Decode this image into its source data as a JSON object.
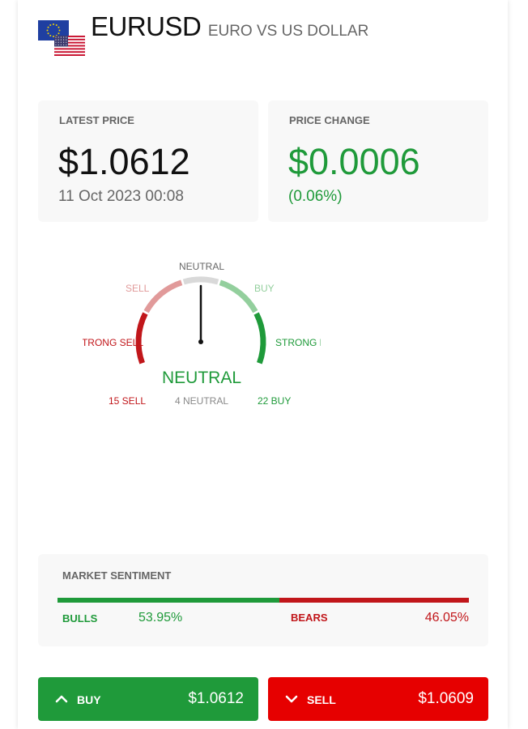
{
  "header": {
    "symbol": "EURUSD",
    "name": "EURO VS US DOLLAR"
  },
  "latest_price": {
    "label": "LATEST PRICE",
    "value": "$1.0612",
    "date": "11 Oct 2023 00:08"
  },
  "price_change": {
    "label": "PRICE CHANGE",
    "value": "$0.0006",
    "percent": "(0.06%)"
  },
  "gauge": {
    "labels": {
      "neutral": "NEUTRAL",
      "sell": "SELL",
      "buy": "BUY",
      "strong_sell": "STRONG SELL",
      "strong_buy": "STRONG BUY"
    },
    "verdict": "NEUTRAL",
    "counts": {
      "sell": "15 SELL",
      "neutral": "4 NEUTRAL",
      "buy": "22 BUY"
    },
    "needle_position": 0.5
  },
  "sentiment": {
    "label": "MARKET SENTIMENT",
    "bulls_label": "BULLS",
    "bulls_value": "53.95%",
    "bulls_fraction": 0.5395,
    "bears_label": "BEARS",
    "bears_value": "46.05%"
  },
  "buy_button": {
    "label": "BUY",
    "price": "$1.0612"
  },
  "sell_button": {
    "label": "SELL",
    "price": "$1.0609"
  },
  "colors": {
    "green": "#1f9a3a",
    "red": "#c1161a",
    "sell_red": "#e60000",
    "light_red": "#e19a9a",
    "light_green": "#93cf9d",
    "neutral_grey": "#d9d9d9"
  }
}
